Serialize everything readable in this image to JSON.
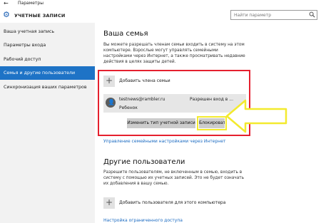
{
  "window": {
    "title": "Параметры"
  },
  "header": {
    "title": "УЧЕТНЫЕ ЗАПИСИ",
    "search_placeholder": "Найти параметр"
  },
  "sidebar": {
    "items": [
      {
        "label": "Ваша учетная запись"
      },
      {
        "label": "Параметры входа"
      },
      {
        "label": "Рабочий доступ"
      },
      {
        "label": "Семья и другие пользователи",
        "active": true
      },
      {
        "label": "Синхронизация ваших параметров"
      }
    ]
  },
  "family": {
    "heading": "Ваша семья",
    "description_lines": [
      "Вы можете разрешать членам семьи входить в систему на этом",
      "компьютере. Взрослые могут управлять семейными",
      "настройками через Интернет, а также просматривать недавние",
      "действия в целях защиты детей."
    ],
    "add_label": "Добавить члена семьи",
    "member": {
      "email": "testnews@rambler.ru",
      "role": "Ребенок",
      "status": "Разрешен вход в ..."
    },
    "change_type_button": "Изменить тип учетной записи",
    "block_button": "Блокировать",
    "manage_link": "Управление семейными настройками через Интернет"
  },
  "others": {
    "heading": "Другие пользователи",
    "description_lines": [
      "Разрешите пользователям, не включенным в семью, входить в",
      "систему с помощью их учетных записей. Это не будет означать",
      "их добавления в вашу семью."
    ],
    "add_label": "Добавить пользователя для этого компьютера",
    "restricted_link": "Настройка ограниченного доступа"
  },
  "colors": {
    "accent": "#1e73c6",
    "highlight_red": "#e5202e",
    "highlight_yellow": "#f3ea2e",
    "link": "#1a6ac1"
  }
}
